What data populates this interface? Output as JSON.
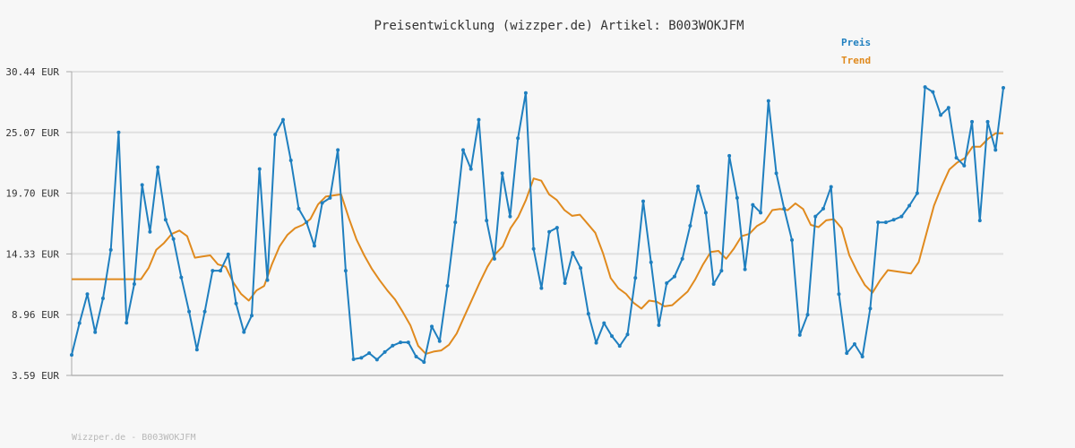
{
  "chart_data": {
    "type": "line",
    "title": "Preisentwicklung (wizzper.de) Artikel: B003WOKJFM",
    "xlabel": "",
    "ylabel": "",
    "y_tick_labels": [
      "3.59 EUR",
      "8.96 EUR",
      "14.33 EUR",
      "19.70 EUR",
      "25.07 EUR",
      "30.44 EUR"
    ],
    "y_ticks": [
      3.59,
      8.96,
      14.33,
      19.7,
      25.07,
      30.44
    ],
    "ylim": [
      3.59,
      30.44
    ],
    "grid": true,
    "legend_position": "top-right",
    "colors": {
      "preis": "#1f7fbf",
      "trend": "#e08a1e",
      "grid": "#e0e0e0",
      "axis": "#aaaaaa"
    },
    "series": [
      {
        "name": "Preis",
        "markers": true,
        "values": [
          5.4,
          8.21,
          10.78,
          7.41,
          10.4,
          14.69,
          25.07,
          8.24,
          11.67,
          20.43,
          16.28,
          21.99,
          17.35,
          15.65,
          12.25,
          9.23,
          5.87,
          9.23,
          12.85,
          12.85,
          14.29,
          9.95,
          7.42,
          8.88,
          21.84,
          12.02,
          24.89,
          26.19,
          22.6,
          18.33,
          17.12,
          15.04,
          18.84,
          19.28,
          23.52,
          12.85,
          5.02,
          5.14,
          5.56,
          4.99,
          5.66,
          6.22,
          6.51,
          6.51,
          5.25,
          4.77,
          7.92,
          6.62,
          11.51,
          17.12,
          23.52,
          21.84,
          26.19,
          17.28,
          13.9,
          21.46,
          17.64,
          24.56,
          28.56,
          14.78,
          11.3,
          16.28,
          16.65,
          11.75,
          14.43,
          13.08,
          9.05,
          6.47,
          8.21,
          7.07,
          6.19,
          7.21,
          12.21,
          18.99,
          13.59,
          8.04,
          11.75,
          12.33,
          13.9,
          16.82,
          20.3,
          17.98,
          11.67,
          12.85,
          23.0,
          19.28,
          12.97,
          18.67,
          17.98,
          27.86,
          21.46,
          18.33,
          15.56,
          7.16,
          8.96,
          17.64,
          18.33,
          20.26,
          10.78,
          5.56,
          6.36,
          5.25,
          9.5,
          17.12,
          17.12,
          17.35,
          17.64,
          18.6,
          19.7,
          29.08,
          28.65,
          26.61,
          27.25,
          22.83,
          22.13,
          26.01,
          17.28,
          26.01,
          23.52,
          29.01
        ]
      },
      {
        "name": "Trend",
        "markers": false,
        "values": [
          12.1,
          12.1,
          12.1,
          12.1,
          12.1,
          12.1,
          12.1,
          12.1,
          12.1,
          12.1,
          13.1,
          14.7,
          15.3,
          16.1,
          16.4,
          15.9,
          14.0,
          14.1,
          14.2,
          13.4,
          13.2,
          11.8,
          10.8,
          10.2,
          11.1,
          11.5,
          13.4,
          15.0,
          16.0,
          16.6,
          16.9,
          17.4,
          18.7,
          19.4,
          19.5,
          19.6,
          17.5,
          15.6,
          14.2,
          13.0,
          12.0,
          11.1,
          10.3,
          9.2,
          8.0,
          6.2,
          5.5,
          5.7,
          5.8,
          6.3,
          7.3,
          8.8,
          10.3,
          11.8,
          13.2,
          14.3,
          15.0,
          16.6,
          17.6,
          19.1,
          21.0,
          20.8,
          19.6,
          19.1,
          18.2,
          17.7,
          17.8,
          17.0,
          16.2,
          14.4,
          12.2,
          11.3,
          10.8,
          10.0,
          9.5,
          10.2,
          10.1,
          9.7,
          9.8,
          10.4,
          11.0,
          12.1,
          13.4,
          14.5,
          14.6,
          13.9,
          14.8,
          15.9,
          16.1,
          16.8,
          17.2,
          18.2,
          18.3,
          18.2,
          18.8,
          18.3,
          16.9,
          16.7,
          17.3,
          17.4,
          16.6,
          14.2,
          12.8,
          11.6,
          10.9,
          12.0,
          12.9,
          12.8,
          12.7,
          12.6,
          13.6,
          16.1,
          18.6,
          20.3,
          21.8,
          22.4,
          22.8,
          23.8,
          23.8,
          24.5,
          25.0,
          25.0
        ]
      }
    ]
  },
  "legend": {
    "preis_label": "Preis",
    "trend_label": "Trend"
  },
  "footer": {
    "text": "Wizzper.de - B003WOKJFM"
  }
}
